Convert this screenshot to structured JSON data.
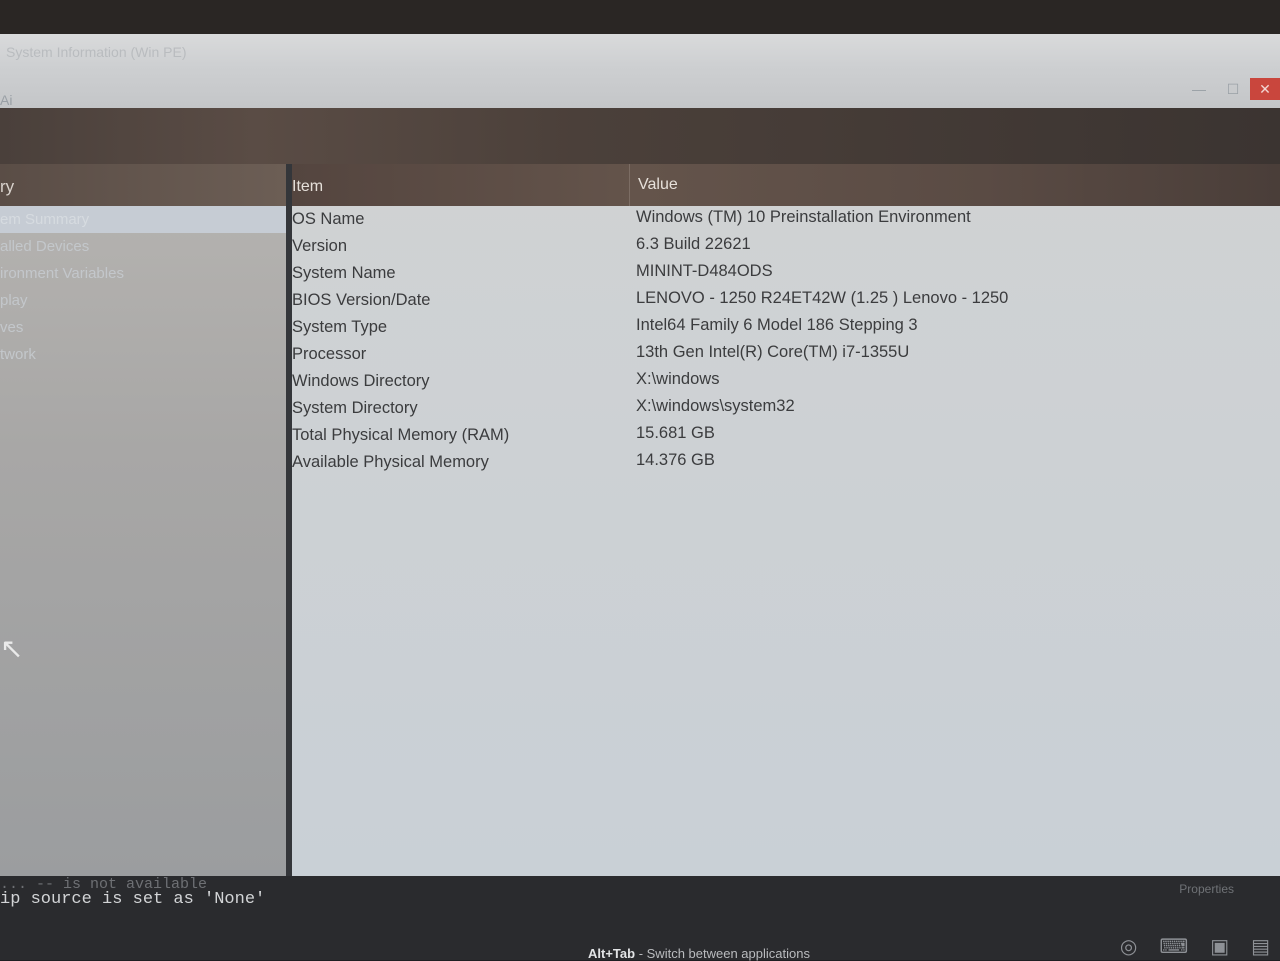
{
  "window": {
    "caption": "System Information (Win PE)",
    "small_title": "Ai",
    "buttons": {
      "minimize": "—",
      "maximize": "☐",
      "close": "✕"
    }
  },
  "sidebar": {
    "header": "ry",
    "items": [
      {
        "label": "em Summary",
        "selected": true
      },
      {
        "label": "alled Devices"
      },
      {
        "label": "ironment Variables"
      },
      {
        "label": "play"
      },
      {
        "label": "ves"
      },
      {
        "label": "twork"
      }
    ]
  },
  "table": {
    "columns": {
      "item": "Item",
      "value": "Value"
    },
    "rows": [
      {
        "item": "OS Name",
        "value": "Windows (TM) 10 Preinstallation Environment"
      },
      {
        "item": "Version",
        "value": "6.3 Build 22621"
      },
      {
        "item": "System Name",
        "value": "MININT-D484ODS"
      },
      {
        "item": "BIOS Version/Date",
        "value": "LENOVO - 1250 R24ET42W (1.25 ) Lenovo - 1250"
      },
      {
        "item": "System Type",
        "value": "Intel64 Family 6 Model 186 Stepping 3"
      },
      {
        "item": "Processor",
        "value": "13th Gen Intel(R) Core(TM) i7-1355U"
      },
      {
        "item": "Windows Directory",
        "value": "X:\\windows"
      },
      {
        "item": "System Directory",
        "value": "X:\\windows\\system32"
      },
      {
        "item": "Total Physical Memory (RAM)",
        "value": "15.681 GB"
      },
      {
        "item": "Available Physical Memory",
        "value": "14.376 GB"
      }
    ]
  },
  "console": {
    "line1": "...   --   is not available",
    "line2": "ip source is set as 'None'",
    "properties_label": "Properties"
  },
  "hint": {
    "keys": "Alt+Tab",
    "text": " - Switch between applications"
  },
  "tray": {
    "icons": [
      "network-icon",
      "keyboard-icon",
      "monitor-icon",
      "app-icon"
    ]
  }
}
